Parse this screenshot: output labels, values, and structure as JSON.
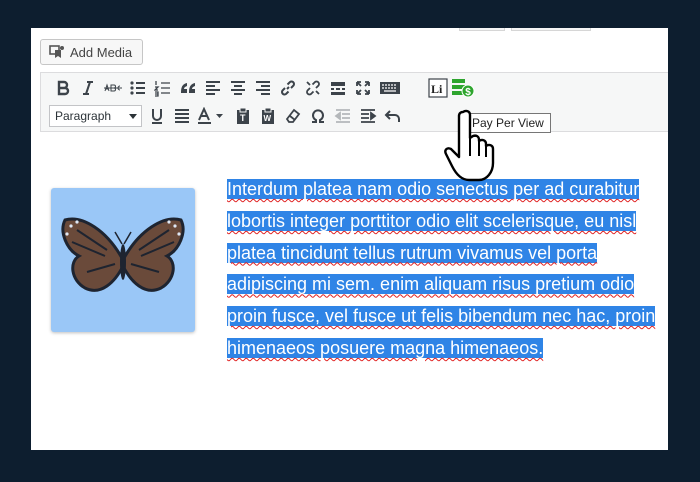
{
  "editor": {
    "add_media_label": "Add Media",
    "format_select": {
      "selected": "Paragraph"
    },
    "toolbar_row1": [
      "bold",
      "italic",
      "strikethrough",
      "bulleted-list",
      "numbered-list",
      "blockquote",
      "align-left",
      "align-center",
      "align-right",
      "insert-link",
      "remove-link",
      "read-more",
      "fullscreen",
      "toolbar-toggle",
      "li-shortcode",
      "pay-per-view"
    ],
    "toolbar_row2": [
      "text-color",
      "paste-as-text",
      "clear-formatting",
      "special-character",
      "outdent",
      "indent",
      "undo"
    ],
    "tooltip": "Pay Per View",
    "paragraph_text": "Interdum platea nam odio senectus per ad curabitur lobortis integer porttitor odio elit scelerisque, eu nisl platea tincidunt tellus rutrum vivamus vel porta adipiscing mi sem. enim aliquam risus pretium odio proin fusce, vel fusce ut felis bibendum nec hac, proin himenaeos posuere magna himenaeos.",
    "image": {
      "subject": "butterfly",
      "selected": true
    },
    "colors": {
      "selection": "#2f84e6",
      "background": "#0d1e2f",
      "pay_per_view_icon": "#2ea52e"
    }
  }
}
